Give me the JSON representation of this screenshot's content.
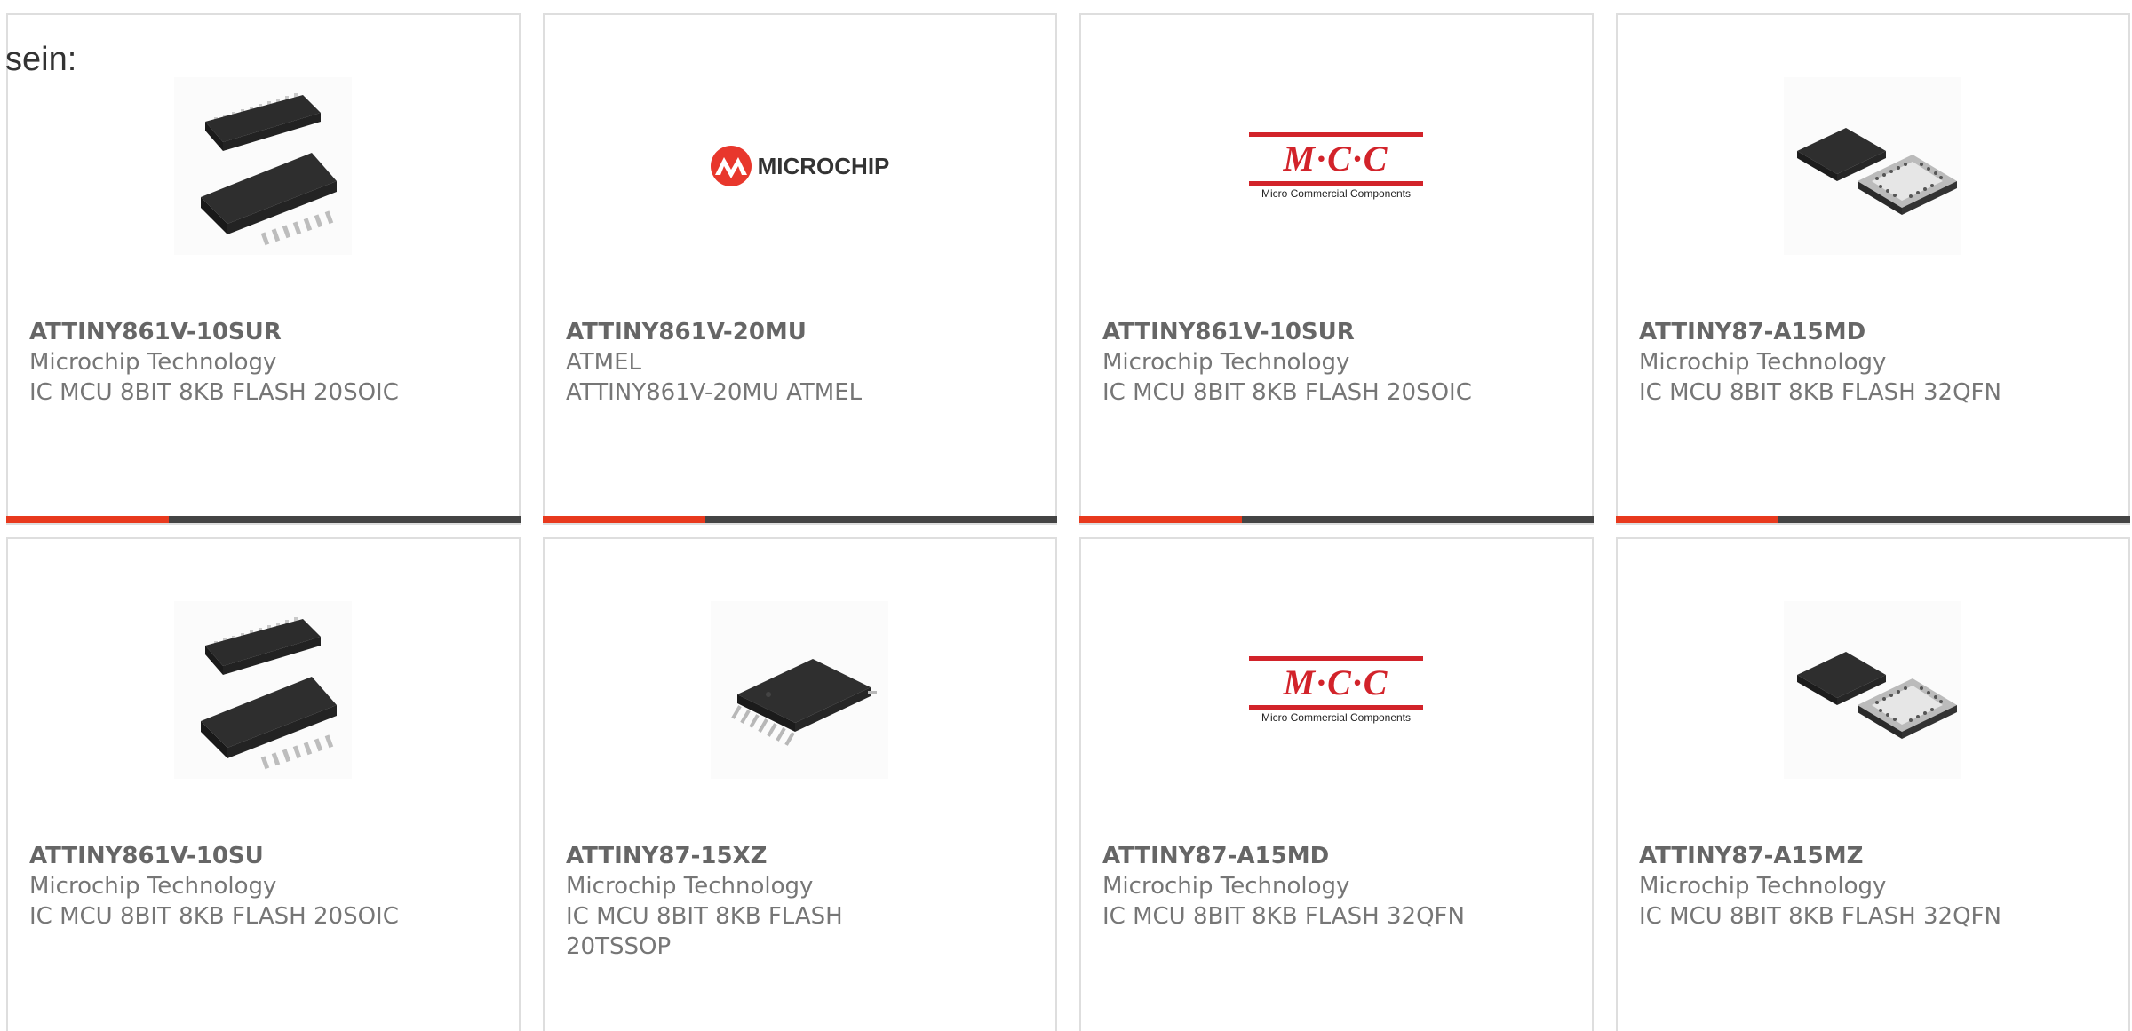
{
  "intro_text": "sein:",
  "accent_colors": {
    "primary": "#e8391d",
    "track": "#444444"
  },
  "cards": [
    {
      "part": "ATTINY861V-10SUR",
      "maker": "Microchip Technology",
      "desc": "IC MCU 8BIT 8KB FLASH 20SOIC",
      "image": "soic-20-chip-icon"
    },
    {
      "part": "ATTINY861V-20MU",
      "maker": "ATMEL",
      "desc": "ATTINY861V-20MU ATMEL",
      "image": "microchip-logo",
      "logo_text": "MICROCHIP"
    },
    {
      "part": "ATTINY861V-10SUR",
      "maker": "Microchip Technology",
      "desc": "IC MCU 8BIT 8KB FLASH 20SOIC",
      "image": "mcc-logo",
      "logo_text": "M·C·C",
      "logo_sub": "Micro Commercial Components"
    },
    {
      "part": "ATTINY87-A15MD",
      "maker": "Microchip Technology",
      "desc": "IC MCU 8BIT 8KB FLASH 32QFN",
      "image": "qfn-32-chip-icon"
    },
    {
      "part": "ATTINY861V-10SU",
      "maker": "Microchip Technology",
      "desc": "IC MCU 8BIT 8KB FLASH 20SOIC",
      "image": "soic-20-chip-icon"
    },
    {
      "part": "ATTINY87-15XZ",
      "maker": "Microchip Technology",
      "desc": "IC MCU 8BIT 8KB FLASH 20TSSOP",
      "image": "tssop-20-chip-icon"
    },
    {
      "part": "ATTINY87-A15MD",
      "maker": "Microchip Technology",
      "desc": "IC MCU 8BIT 8KB FLASH 32QFN",
      "image": "mcc-logo",
      "logo_text": "M·C·C",
      "logo_sub": "Micro Commercial Components"
    },
    {
      "part": "ATTINY87-A15MZ",
      "maker": "Microchip Technology",
      "desc": "IC MCU 8BIT 8KB FLASH 32QFN",
      "image": "qfn-32-chip-icon"
    }
  ]
}
